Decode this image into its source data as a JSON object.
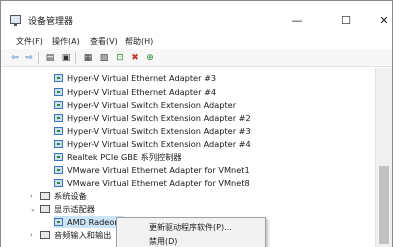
{
  "window": {
    "title": "设备管理器",
    "minimize_glyph": "—",
    "maximize_glyph": "☐",
    "close_glyph": "✕"
  },
  "menu": [
    "文件(F)",
    "操作(A)",
    "查看(V)",
    "帮助(H)"
  ],
  "toolbar": {
    "icons": [
      "back-arrow-icon",
      "forward-arrow-icon",
      "properties-icon",
      "help-icon",
      "update-driver-icon",
      "scan-hardware-icon",
      "remove-device-icon",
      "uninstall-icon",
      "enable-device-icon"
    ]
  },
  "tree": {
    "network_adapters": [
      "Hyper-V Virtual Ethernet Adapter #3",
      "Hyper-V Virtual Ethernet Adapter #4",
      "Hyper-V Virtual Switch Extension Adapter",
      "Hyper-V Virtual Switch Extension Adapter #2",
      "Hyper-V Virtual Switch Extension Adapter #3",
      "Hyper-V Virtual Switch Extension Adapter #4",
      "Realtek PCIe GBE 系列控制器",
      "VMware Virtual Ethernet Adapter for VMnet1",
      "VMware Virtual Ethernet Adapter for VMnet8"
    ],
    "system_devices": "系统设备",
    "display_adapters": "显示适配器",
    "amd_adapter": "AMD Radeon H",
    "audio_io": "音频输入和输出"
  },
  "context_menu": {
    "update_driver": "更新驱动程序软件(P)...",
    "disable": "禁用(D)"
  }
}
